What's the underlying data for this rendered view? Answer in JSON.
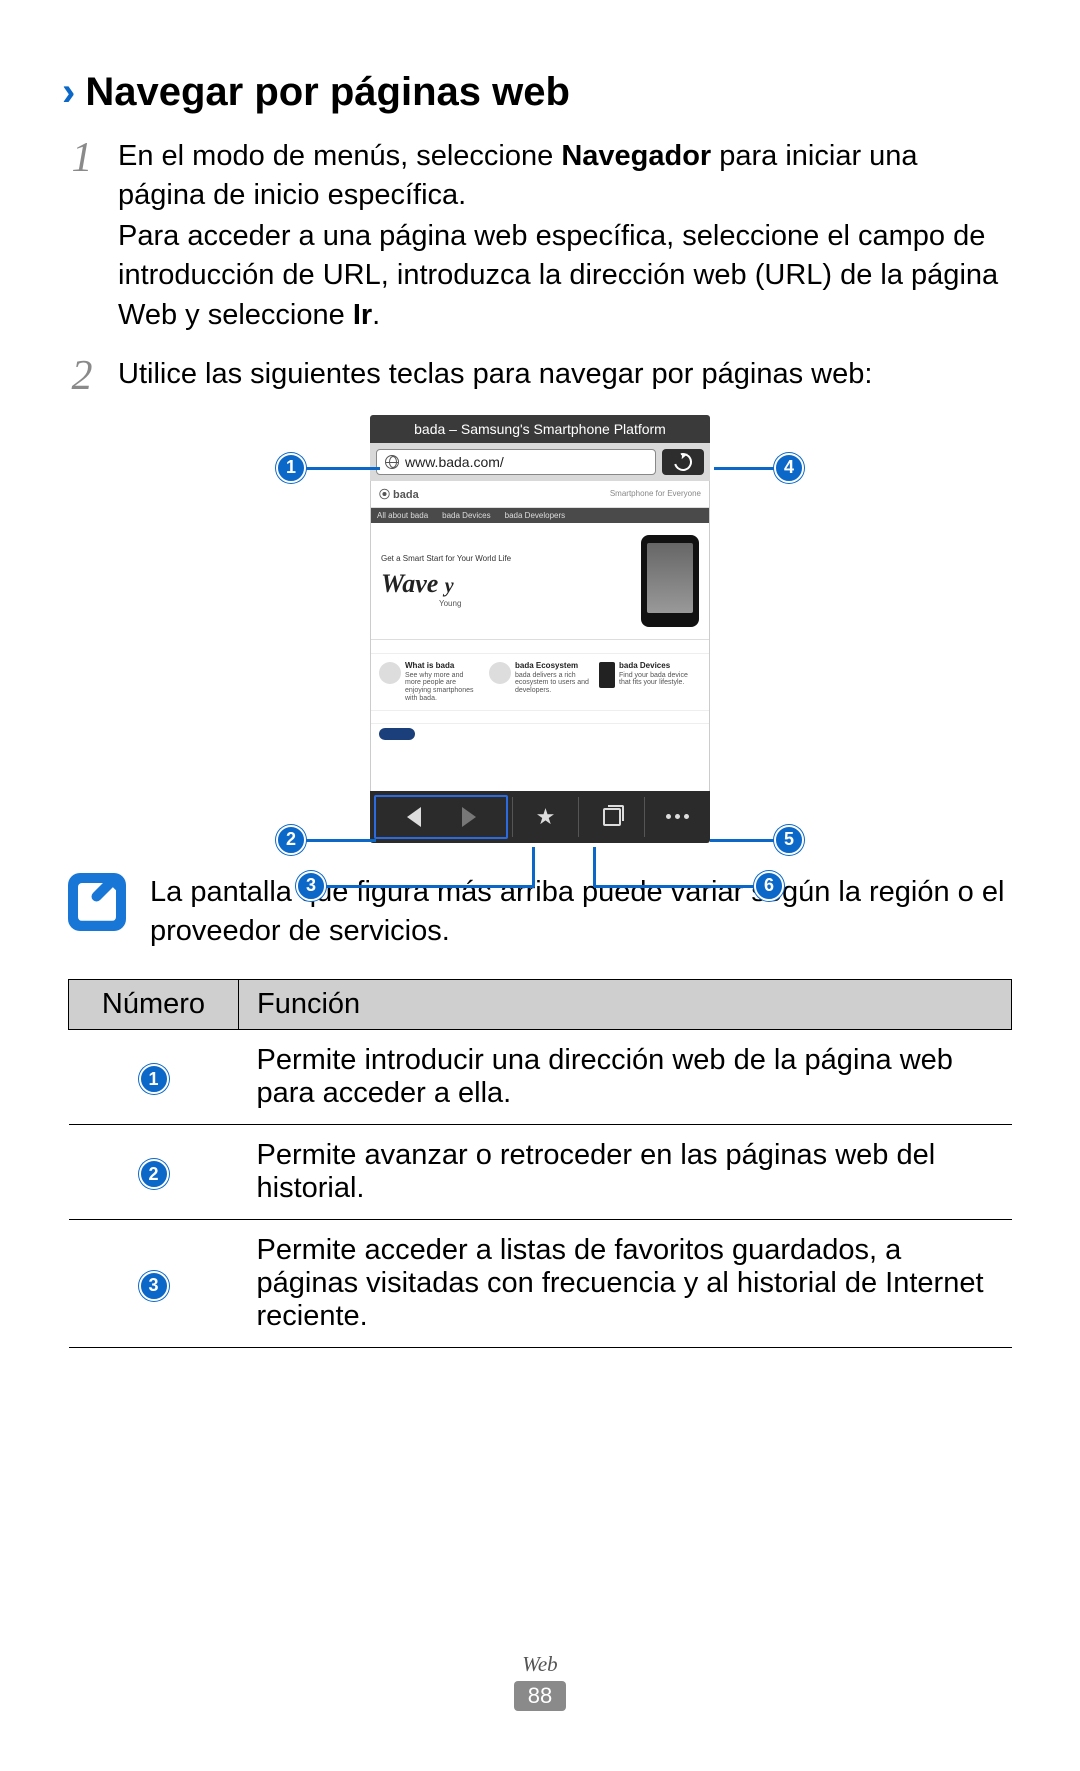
{
  "heading": "Navegar por páginas web",
  "steps": {
    "s1": {
      "num": "1",
      "p1a": "En el modo de menús, seleccione ",
      "p1b": "Navegador",
      "p1c": " para iniciar una página de inicio específica.",
      "p2a": "Para acceder a una página web específica, seleccione el campo de introducción de URL, introduzca la dirección web (URL) de la página Web y seleccione ",
      "p2b": "Ir",
      "p2c": "."
    },
    "s2": {
      "num": "2",
      "text": "Utilice las siguientes teclas para navegar por páginas web:"
    }
  },
  "screenshot": {
    "titlebar": "bada – Samsung's Smartphone Platform",
    "url": "www.bada.com/",
    "bada_logo": "⦿ bada",
    "sub_label": "Smartphone for Everyone",
    "tabs": {
      "t1": "All about bada",
      "t2": "bada Devices",
      "t3": "bada Developers"
    },
    "hero_tag": "Get a Smart Start for Your World Life",
    "wave": "Wave",
    "wave_y": "y",
    "young": "Young",
    "features": {
      "f1": {
        "title": "What is bada",
        "desc": "See why more and more people are enjoying smartphones with bada."
      },
      "f2": {
        "title": "bada Ecosystem",
        "desc": "bada delivers a rich ecosystem to users and developers."
      },
      "f3": {
        "title": "bada Devices",
        "desc": "Find your bada device that fits your lifestyle."
      }
    },
    "callouts": {
      "c1": "1",
      "c2": "2",
      "c3": "3",
      "c4": "4",
      "c5": "5",
      "c6": "6"
    }
  },
  "note": "La pantalla que figura más arriba puede variar según la región o el proveedor de servicios.",
  "table": {
    "h1": "Número",
    "h2": "Función",
    "rows": {
      "r1": {
        "n": "1",
        "f": "Permite introducir una dirección web de la página web para acceder a ella."
      },
      "r2": {
        "n": "2",
        "f": "Permite avanzar o retroceder en las páginas web del historial."
      },
      "r3": {
        "n": "3",
        "f": "Permite acceder a listas de favoritos guardados, a páginas visitadas con frecuencia y al historial de Internet reciente."
      }
    }
  },
  "footer": {
    "section": "Web",
    "page": "88"
  }
}
